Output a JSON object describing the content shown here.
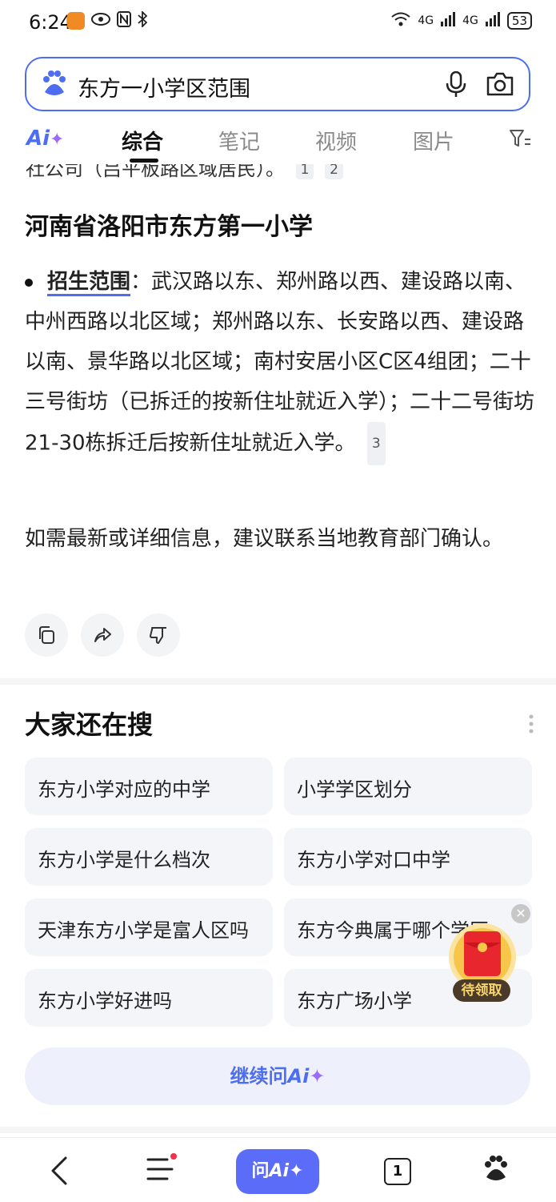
{
  "status_bar": {
    "time": "6:24",
    "battery": "53",
    "network1": "4G",
    "network2": "4G"
  },
  "search": {
    "query": "东方一小学区范围"
  },
  "tabs": [
    "综合",
    "笔记",
    "视频",
    "图片"
  ],
  "ai_label": "Ai",
  "content": {
    "cut_line": "社公司（吕平板路区域居民）。",
    "cite1": "1",
    "cite2": "2",
    "school_title": "河南省洛阳市东方第一小学",
    "bullet_label": "招生范围",
    "bullet_text": "：武汉路以东、郑州路以西、建设路以南、中州西路以北区域；郑州路以东、长安路以西、建设路以南、景华路以北区域；南村安居小区C区4组团；二十三号街坊（已拆迁的按新住址就近入学）；二十二号街坊21-30栋拆迁后按新住址就近入学。",
    "cite3": "3",
    "note": "如需最新或详细信息，建议联系当地教育部门确认。"
  },
  "related": {
    "title": "大家还在搜",
    "items": [
      "东方小学对应的中学",
      "小学学区划分",
      "东方小学是什么档次",
      "东方小学对口中学",
      "天津东方小学是富人区吗",
      "东方今典属于哪个学区",
      "东方小学好进吗",
      "东方广场小学"
    ]
  },
  "continue_label": "继续问",
  "redpacket_label": "待领取",
  "bottom_nav": {
    "ask_label": "问",
    "tab_count": "1"
  }
}
